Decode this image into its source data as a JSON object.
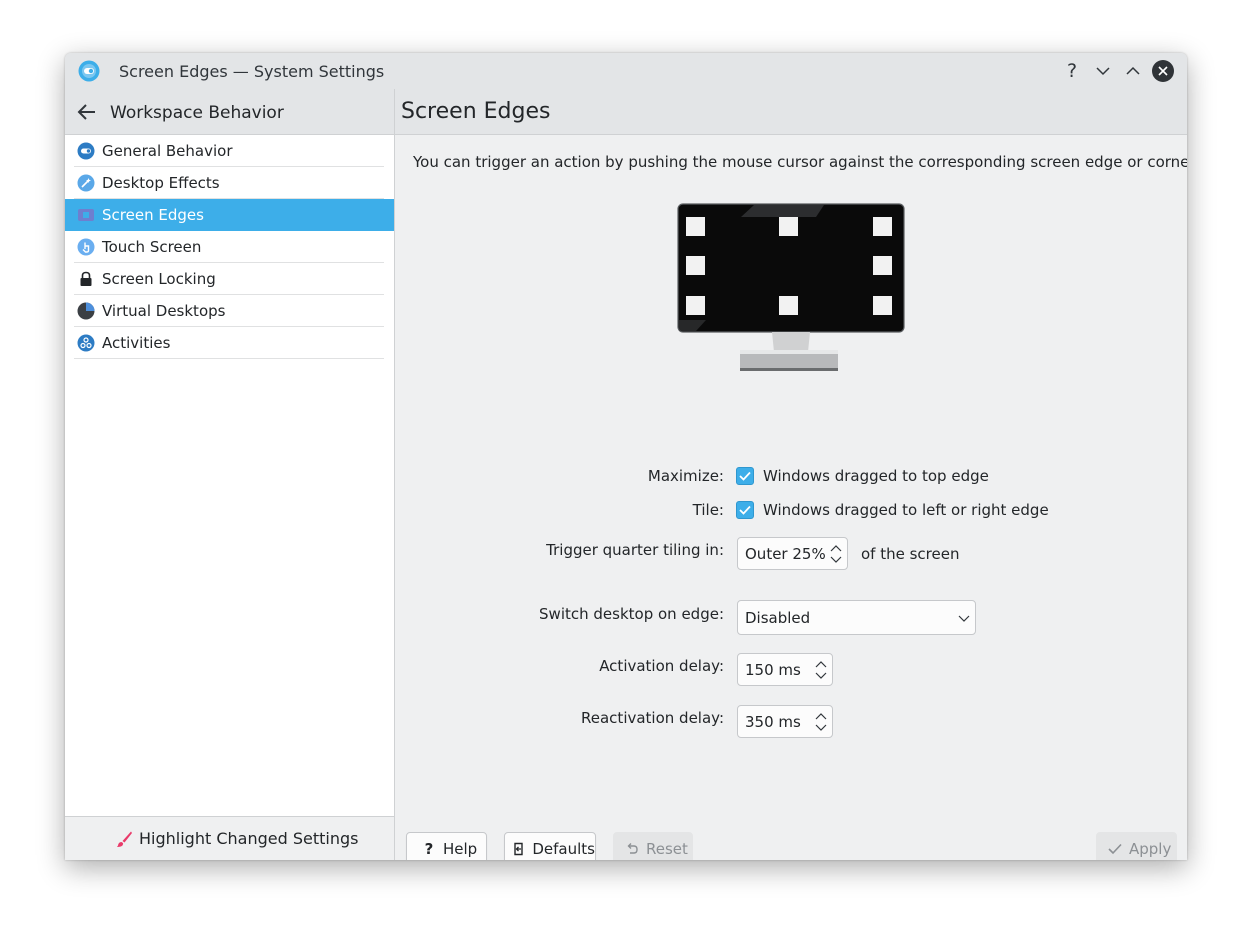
{
  "window": {
    "title": "Screen Edges — System Settings"
  },
  "sidebar": {
    "header": "Workspace Behavior",
    "items": [
      {
        "label": "General Behavior",
        "icon": "general-behavior-icon",
        "active": false
      },
      {
        "label": "Desktop Effects",
        "icon": "desktop-effects-icon",
        "active": false
      },
      {
        "label": "Screen Edges",
        "icon": "screen-edges-icon",
        "active": true
      },
      {
        "label": "Touch Screen",
        "icon": "touch-screen-icon",
        "active": false
      },
      {
        "label": "Screen Locking",
        "icon": "lock-icon",
        "active": false
      },
      {
        "label": "Virtual Desktops",
        "icon": "virtual-desktops-icon",
        "active": false
      },
      {
        "label": "Activities",
        "icon": "activities-icon",
        "active": false
      }
    ],
    "footer": "Highlight Changed Settings"
  },
  "main": {
    "title": "Screen Edges",
    "description": "You can trigger an action by pushing the mouse cursor against the corresponding screen edge or corner.",
    "maximize": {
      "label": "Maximize:",
      "checked": true,
      "text": "Windows dragged to top edge"
    },
    "tile": {
      "label": "Tile:",
      "checked": true,
      "text": "Windows dragged to left or right edge"
    },
    "quarter_tiling": {
      "label": "Trigger quarter tiling in:",
      "value": "Outer 25%",
      "suffix": "of the screen"
    },
    "switch_desktop": {
      "label": "Switch desktop on edge:",
      "value": "Disabled"
    },
    "activation_delay": {
      "label": "Activation delay:",
      "value": "150 ms"
    },
    "reactivation_delay": {
      "label": "Reactivation delay:",
      "value": "350 ms"
    }
  },
  "buttons": {
    "help": "Help",
    "defaults": "Defaults",
    "reset": "Reset",
    "apply": "Apply"
  },
  "colors": {
    "accent": "#3daee9",
    "highlight_brush": "#e93a6a"
  }
}
